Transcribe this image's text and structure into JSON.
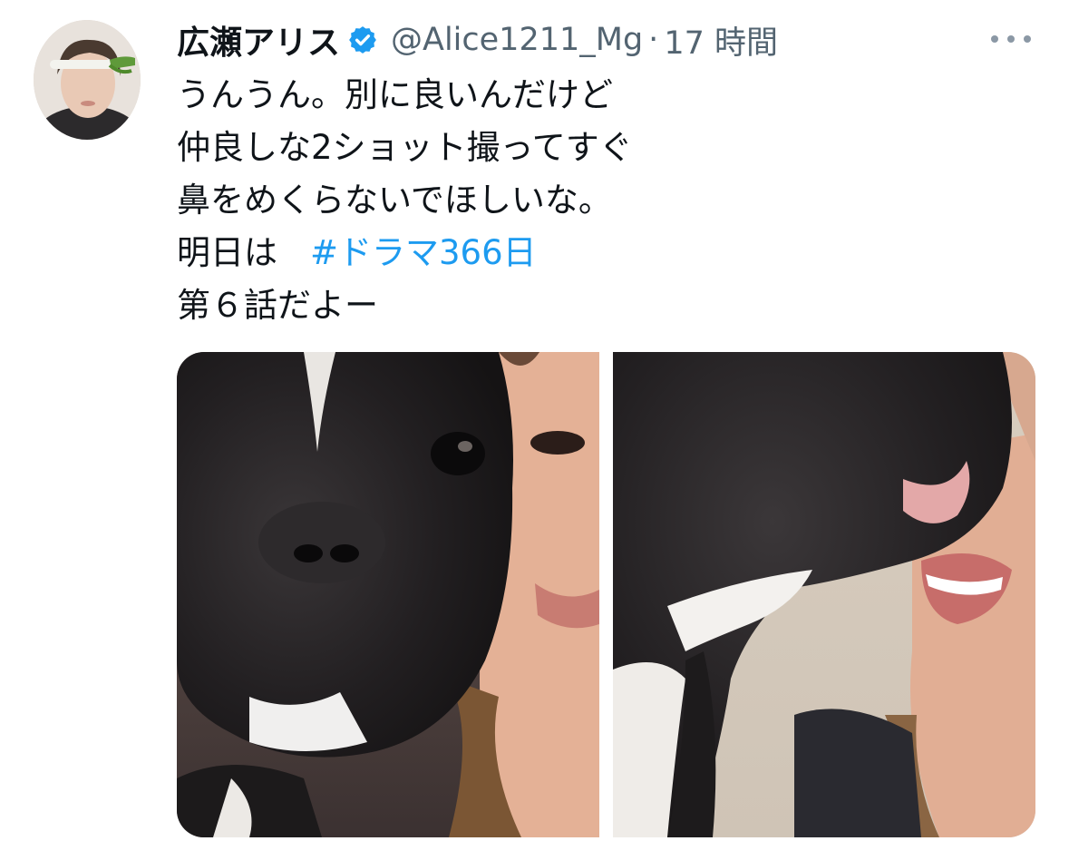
{
  "tweet": {
    "display_name": "広瀬アリス",
    "handle": "@Alice1211_Mg",
    "separator": "·",
    "time": "17 時間",
    "text_lines": [
      "うんうん。別に良いんだけど",
      "仲良しな2ショット撮ってすぐ",
      "鼻をめくらないでほしいな。"
    ],
    "line4_prefix": "明日は",
    "hashtag": "#ドラマ366日",
    "line5": "第６話だよー",
    "icons": {
      "verified": "verified-badge-icon",
      "more": "more-options-icon"
    },
    "colors": {
      "text": "#0f1419",
      "secondary": "#536471",
      "link": "#1d9bf0",
      "verified": "#1d9bf0"
    },
    "media_count": 2
  }
}
